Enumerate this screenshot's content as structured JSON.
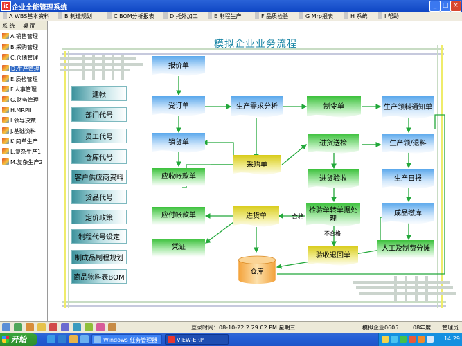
{
  "window": {
    "title": "企业全能管理系统",
    "icon_label": "iE"
  },
  "menu": [
    "A WBS基本资料",
    "B 制造规划",
    "C BOM分析报表",
    "D 托外加工",
    "E 制程生产",
    "F 品质检验",
    "G Mrp报表",
    "H 系统",
    "I 帮助"
  ],
  "sidebar": {
    "tabs": [
      "系 统",
      "桌 面"
    ],
    "items": [
      "A.销售管理",
      "B.采购管理",
      "C.仓储管理",
      "D.生产管理",
      "E.质检管理",
      "F.人事管理",
      "G.财务管理",
      "H.MRPII",
      "I.领导决策",
      "J.基础资料",
      "K.简单生产",
      "L.复杂生产1",
      "M.复杂生产2"
    ],
    "selected_index": 3
  },
  "flow": {
    "title": "模拟企业业务流程",
    "left_buttons": [
      "建帐",
      "部门代号",
      "员工代号",
      "仓库代号",
      "客户供应商资料",
      "货品代号",
      "定价政策",
      "制程代号设定",
      "制成品制程规划",
      "商品物料表BOM"
    ],
    "nodes": {
      "quote": "报价单",
      "order": "受订单",
      "delivery": "销货单",
      "receivable": "应收帐款单",
      "payable": "应付帐款单",
      "voucher": "凭证",
      "demand": "生产需求分析",
      "purchase": "采购单",
      "receipt": "进货单",
      "warehouse": "仓库",
      "work_order": "制令单",
      "incoming": "进货送检",
      "acceptance": "进货验收",
      "convert": "检验单转单据处理",
      "return": "验收退回单",
      "picking": "生产领料通知单",
      "issue": "生产领/退料",
      "daily": "生产日报",
      "finished": "成品缴库",
      "labor": "人工及制费分摊"
    },
    "labels": {
      "pass": "合格",
      "fail": "不合格"
    }
  },
  "status": {
    "login_time": "登录时间：08-10-22 2:29:02 PM  星期三",
    "company": "模拟企业0605",
    "year": "08年度",
    "user": "管理员"
  },
  "taskbar": {
    "start": "开始",
    "tasks": [
      "Windows 任务管理器",
      "VIEW-ERP"
    ],
    "clock": "14:29"
  }
}
